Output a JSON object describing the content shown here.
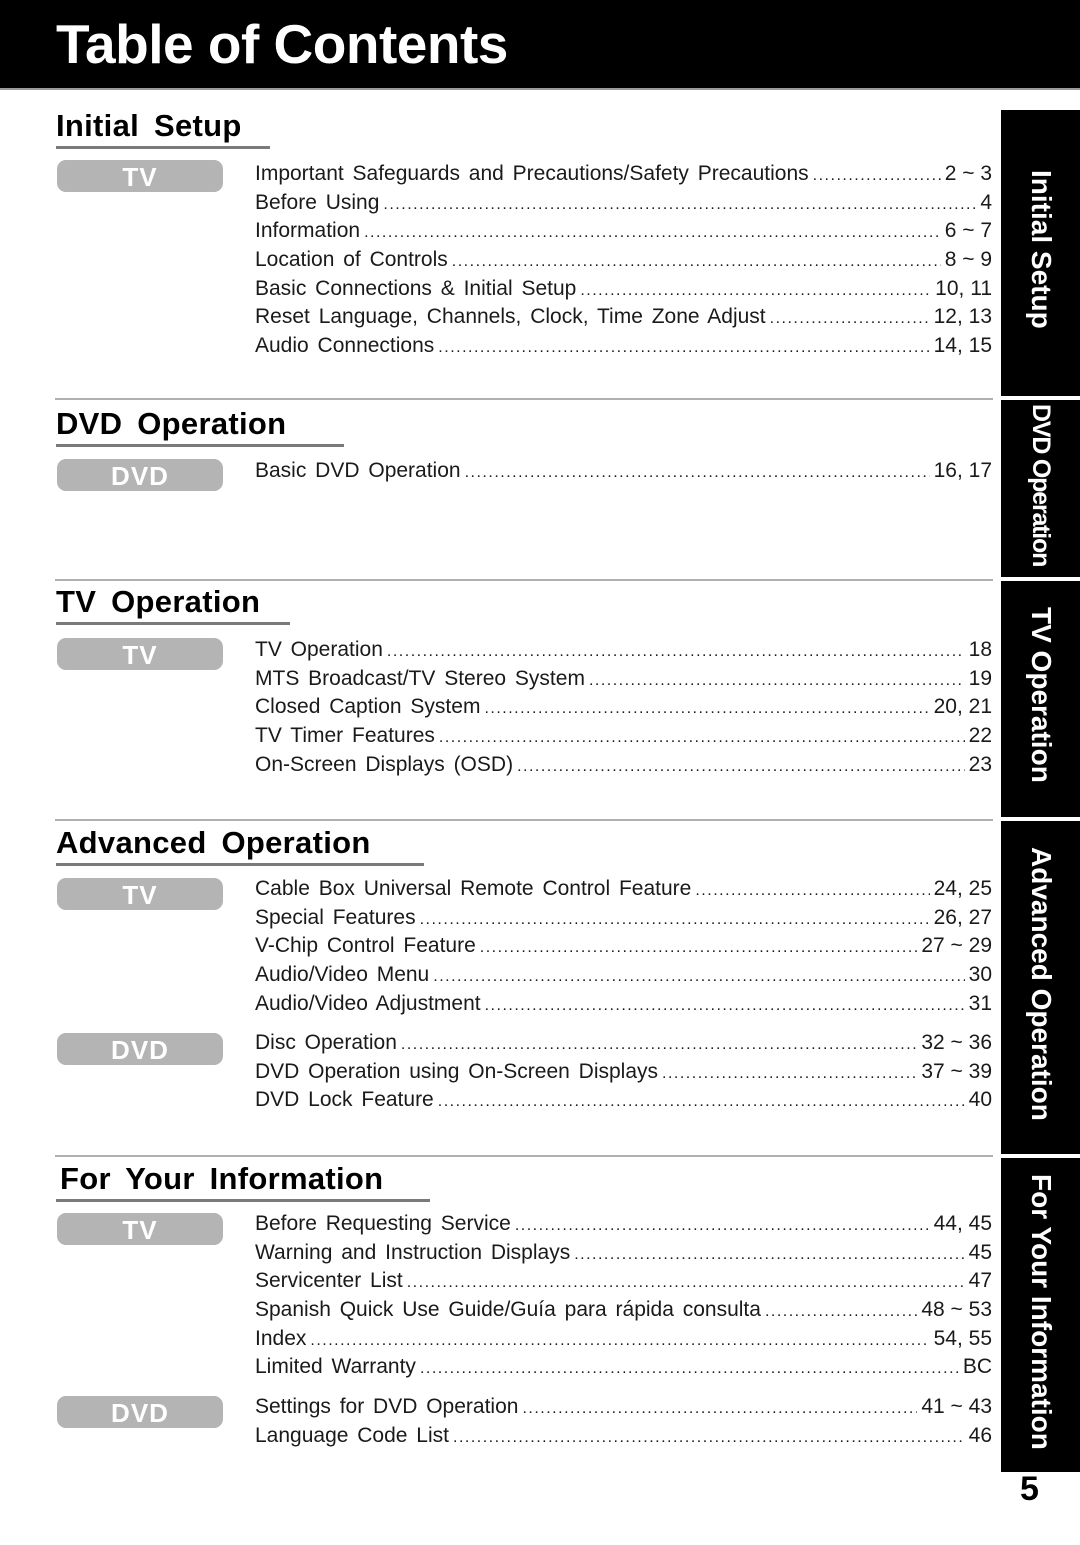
{
  "header": {
    "title": "Table of Contents"
  },
  "sections": [
    {
      "title": "Initial Setup",
      "groups": [
        {
          "badge": "TV",
          "entries": [
            {
              "label": "Important Safeguards and Precautions/Safety Precautions",
              "pages": "2 ~ 3"
            },
            {
              "label": "Before Using",
              "pages": "4"
            },
            {
              "label": "Information",
              "pages": "6 ~ 7"
            },
            {
              "label": "Location of Controls",
              "pages": "8 ~ 9"
            },
            {
              "label": "Basic Connections & Initial Setup",
              "pages": "10, 11"
            },
            {
              "label": "Reset Language, Channels, Clock, Time Zone Adjust",
              "pages": "12, 13"
            },
            {
              "label": "Audio Connections",
              "pages": "14, 15"
            }
          ]
        }
      ]
    },
    {
      "title": "DVD Operation",
      "groups": [
        {
          "badge": "DVD",
          "entries": [
            {
              "label": "Basic DVD Operation",
              "pages": "16, 17"
            }
          ]
        }
      ]
    },
    {
      "title": "TV Operation",
      "groups": [
        {
          "badge": "TV",
          "entries": [
            {
              "label": "TV Operation",
              "pages": "18"
            },
            {
              "label": "MTS Broadcast/TV Stereo System",
              "pages": "19"
            },
            {
              "label": "Closed Caption System",
              "pages": "20, 21"
            },
            {
              "label": "TV Timer Features",
              "pages": "22"
            },
            {
              "label": "On-Screen Displays (OSD)",
              "pages": "23"
            }
          ]
        }
      ]
    },
    {
      "title": "Advanced Operation",
      "groups": [
        {
          "badge": "TV",
          "entries": [
            {
              "label": "Cable Box Universal Remote Control Feature",
              "pages": "24, 25"
            },
            {
              "label": "Special Features",
              "pages": "26, 27"
            },
            {
              "label": "V-Chip Control Feature",
              "pages": "27 ~ 29"
            },
            {
              "label": "Audio/Video Menu",
              "pages": "30"
            },
            {
              "label": "Audio/Video Adjustment",
              "pages": "31"
            }
          ]
        },
        {
          "badge": "DVD",
          "entries": [
            {
              "label": "Disc Operation",
              "pages": "32 ~ 36"
            },
            {
              "label": "DVD Operation using On-Screen Displays",
              "pages": "37 ~ 39"
            },
            {
              "label": "DVD Lock Feature",
              "pages": "40"
            }
          ]
        }
      ]
    },
    {
      "title": "For Your Information",
      "groups": [
        {
          "badge": "TV",
          "entries": [
            {
              "label": "Before Requesting Service",
              "pages": "44, 45"
            },
            {
              "label": "Warning and Instruction Displays",
              "pages": "45"
            },
            {
              "label": "Servicenter List",
              "pages": "47"
            },
            {
              "label": "Spanish Quick Use Guide/Guía para rápida consulta",
              "pages": "48 ~ 53"
            },
            {
              "label": "Index",
              "pages": "54, 55"
            },
            {
              "label": "Limited Warranty",
              "pages": "BC"
            }
          ]
        },
        {
          "badge": "DVD",
          "entries": [
            {
              "label": "Settings for DVD Operation",
              "pages": "41 ~ 43"
            },
            {
              "label": "Language Code List",
              "pages": "46"
            }
          ]
        }
      ]
    }
  ],
  "side_tabs": [
    {
      "label": "Initial Setup"
    },
    {
      "label": "DVD Operation"
    },
    {
      "label": "TV Operation"
    },
    {
      "label": "Advanced Operation"
    },
    {
      "label": "For Your Information"
    }
  ],
  "page_number": "5",
  "colors": {
    "header_bg": "#000000",
    "badge_bg": "#b4b4b4",
    "underline": "#7a7a7a",
    "divider": "#b0b0b0"
  }
}
